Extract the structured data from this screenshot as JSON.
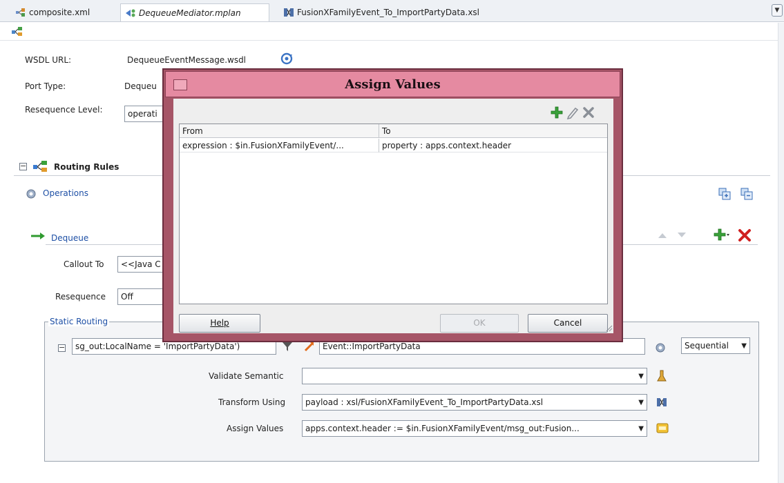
{
  "tabs": [
    {
      "label": "composite.xml",
      "icon": "composite-icon",
      "active": false
    },
    {
      "label": "DequeueMediator.mplan",
      "icon": "mediator-icon",
      "active": true
    },
    {
      "label": "FusionXFamilyEvent_To_ImportPartyData.xsl",
      "icon": "xsl-map-icon",
      "active": false
    }
  ],
  "toolbar": {
    "icon": "routing-rules-icon"
  },
  "form": {
    "wsdl_url_label": "WSDL URL:",
    "wsdl_url_value": "DequeueEventMessage.wsdl",
    "port_type_label": "Port Type:",
    "port_type_value": "Dequeu",
    "resequence_level_label": "Resequence Level:",
    "resequence_level_value": "operati"
  },
  "routing": {
    "section_title": "Routing Rules",
    "operations_label": "Operations",
    "dequeue_label": "Dequeue",
    "callout_label": "Callout To",
    "callout_value": "<<Java C",
    "resequence_label": "Resequence",
    "resequence_value": "Off",
    "static_routing_title": "Static Routing",
    "filter_expression": "sg_out:LocalName = 'ImportPartyData')",
    "target_value": "Event::ImportPartyData",
    "sequential_value": "Sequential",
    "validate_semantic_label": "Validate Semantic",
    "validate_semantic_value": "",
    "transform_using_label": "Transform Using",
    "transform_using_value": "payload : xsl/FusionXFamilyEvent_To_ImportPartyData.xsl",
    "assign_values_label": "Assign Values",
    "assign_values_value": "apps.context.header := $in.FusionXFamilyEvent/msg_out:Fusion..."
  },
  "dialog": {
    "title": "Assign Values",
    "columns": [
      "From",
      "To"
    ],
    "rows": [
      {
        "from": "expression : $in.FusionXFamilyEvent/...",
        "to": "property : apps.context.header"
      }
    ],
    "help_label": "Help",
    "ok_label": "OK",
    "cancel_label": "Cancel"
  },
  "colors": {
    "dialog_frame": "#a65567",
    "dialog_title": "#e58aa1",
    "link": "#1d4fa5",
    "add": "#3aa13a",
    "delete": "#d02020"
  }
}
